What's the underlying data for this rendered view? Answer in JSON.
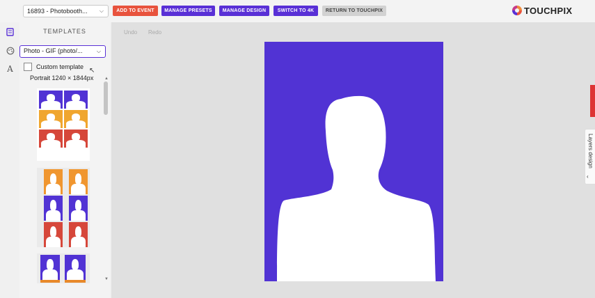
{
  "topbar": {
    "event_select_value": "16893 - Photobooth...",
    "add_to_event": "ADD TO EVENT",
    "manage_presets": "MANAGE PRESETS",
    "manage_design": "MANAGE DESIGN",
    "switch_4k": "SWITCH TO 4K",
    "return_touchpix": "RETURN TO TOUCHPIX",
    "logo_text": "TOUCHPIX"
  },
  "sidebar": {
    "title": "TEMPLATES",
    "type_select_value": "Photo - GIF (photo/...",
    "custom_template_label": "Custom template",
    "size_label": "Portrait 1240 × 1844px"
  },
  "toolbar": {
    "undo": "Undo",
    "redo": "Redo"
  },
  "right_panel": {
    "layers_tab": "Layers design"
  },
  "colors": {
    "purple": "#5133d4",
    "orange": "#f0962f",
    "red": "#d6473a",
    "accent_button": "#5930d6",
    "add_button": "#e8533d"
  },
  "icons": [
    "template-icon",
    "palette-icon",
    "text-icon",
    "chevron-down-icon",
    "cursor-icon",
    "chevron-left-icon"
  ]
}
